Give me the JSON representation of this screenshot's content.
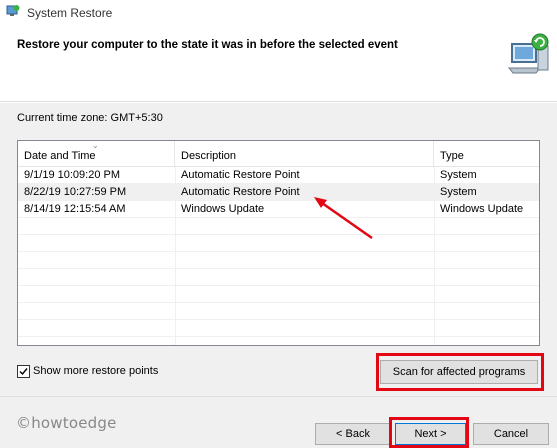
{
  "window": {
    "title": "System Restore",
    "icon": "system-restore-icon"
  },
  "header": {
    "title": "Restore your computer to the state it was in before the selected event",
    "icon": "restore-computer-icon"
  },
  "timezone": {
    "label": "Current time zone: GMT+5:30"
  },
  "list": {
    "columns": [
      "Date and Time",
      "Description",
      "Type"
    ],
    "rows": [
      {
        "date": "9/1/19 10:09:20 PM",
        "description": "Automatic Restore Point",
        "type": "System"
      },
      {
        "date": "8/22/19 10:27:59 PM",
        "description": "Automatic Restore Point",
        "type": "System",
        "selected": true
      },
      {
        "date": "8/14/19 12:15:54 AM",
        "description": "Windows Update",
        "type": "Windows Update"
      }
    ],
    "empty_rows": 7
  },
  "options": {
    "show_more_label": "Show more restore points",
    "show_more_checked": true,
    "scan_label": "Scan for affected programs"
  },
  "footer": {
    "watermark": "©howtoedge",
    "back_label": "< Back",
    "next_label": "Next >",
    "cancel_label": "Cancel"
  },
  "colors": {
    "highlight": "#e30613",
    "accent": "#0078d7"
  }
}
